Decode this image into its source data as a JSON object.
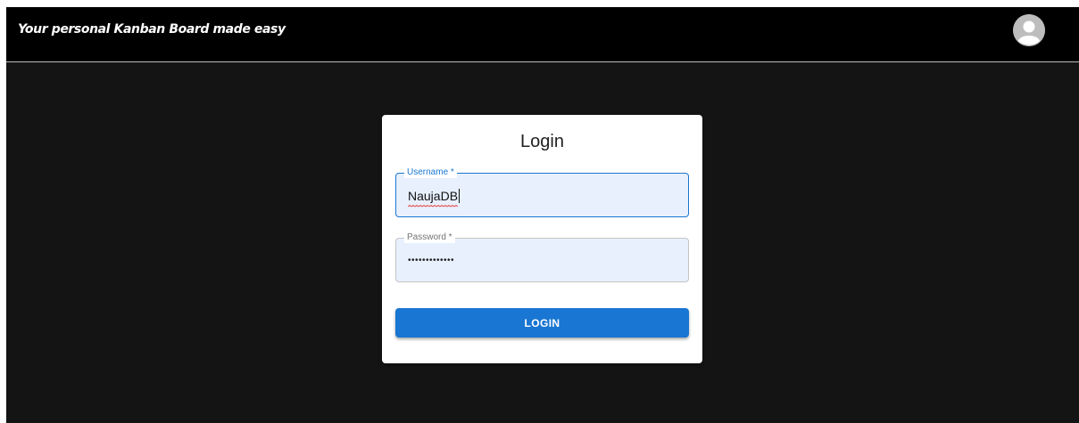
{
  "header": {
    "brand": "Your personal Kanban Board made easy",
    "avatar_icon": "account-circle-icon"
  },
  "login_card": {
    "title": "Login",
    "username": {
      "label": "Username *",
      "value": "NaujaDB"
    },
    "password": {
      "label": "Password *",
      "masked_value": "•••••••••••••"
    },
    "submit_label": "LOGIN"
  },
  "colors": {
    "topbar": "#000000",
    "page_background": "#141414",
    "primary": "#1976d2",
    "field_fill": "#e8f0fe",
    "card": "#ffffff"
  }
}
